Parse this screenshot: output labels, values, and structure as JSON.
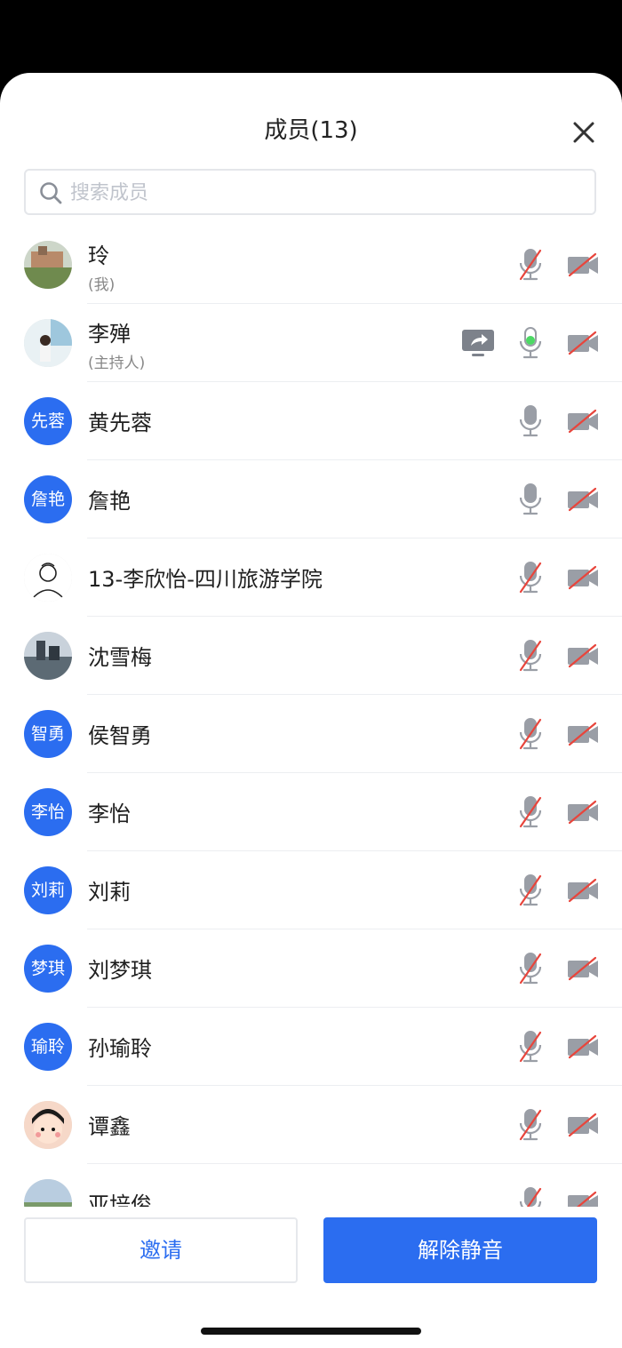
{
  "header": {
    "title": "成员(13)"
  },
  "search": {
    "placeholder": "搜索成员"
  },
  "members": [
    {
      "name": "玲",
      "subtitle": "(我)",
      "avatar_type": "photo",
      "avatar_icon": "photo-garden-avatar",
      "mic": "muted",
      "camera": "off"
    },
    {
      "name": "李殚",
      "subtitle": "(主持人)",
      "avatar_type": "photo",
      "avatar_icon": "photo-girl-avatar",
      "mic": "active",
      "camera": "off",
      "sharing": true
    },
    {
      "name": "黄先蓉",
      "avatar_type": "text",
      "avatar_text": "先蓉",
      "mic": "on",
      "camera": "off"
    },
    {
      "name": "詹艳",
      "avatar_type": "text",
      "avatar_text": "詹艳",
      "mic": "on",
      "camera": "off"
    },
    {
      "name": "13-李欣怡-四川旅游学院",
      "avatar_type": "photo",
      "avatar_icon": "sketch-avatar",
      "mic": "muted",
      "camera": "off"
    },
    {
      "name": "沈雪梅",
      "avatar_type": "photo",
      "avatar_icon": "photo-city-avatar",
      "mic": "muted",
      "camera": "off"
    },
    {
      "name": "侯智勇",
      "avatar_type": "text",
      "avatar_text": "智勇",
      "mic": "muted",
      "camera": "off"
    },
    {
      "name": "李怡",
      "avatar_type": "text",
      "avatar_text": "李怡",
      "mic": "muted",
      "camera": "off"
    },
    {
      "name": "刘莉",
      "avatar_type": "text",
      "avatar_text": "刘莉",
      "mic": "muted",
      "camera": "off"
    },
    {
      "name": "刘梦琪",
      "avatar_type": "text",
      "avatar_text": "梦琪",
      "mic": "muted",
      "camera": "off"
    },
    {
      "name": "孙瑜聆",
      "avatar_type": "text",
      "avatar_text": "瑜聆",
      "mic": "muted",
      "camera": "off"
    },
    {
      "name": "谭鑫",
      "avatar_type": "photo",
      "avatar_icon": "cartoon-avatar",
      "mic": "muted",
      "camera": "off"
    },
    {
      "name": "亚培俊",
      "avatar_type": "photo",
      "avatar_icon": "photo-landscape-avatar",
      "mic": "muted",
      "camera": "off"
    }
  ],
  "footer": {
    "invite_label": "邀请",
    "unmute_label": "解除静音"
  },
  "colors": {
    "accent": "#2b6df0",
    "muted_slash": "#e8453c",
    "mic_active": "#4cd964",
    "icon_gray": "#9a9ea6"
  }
}
